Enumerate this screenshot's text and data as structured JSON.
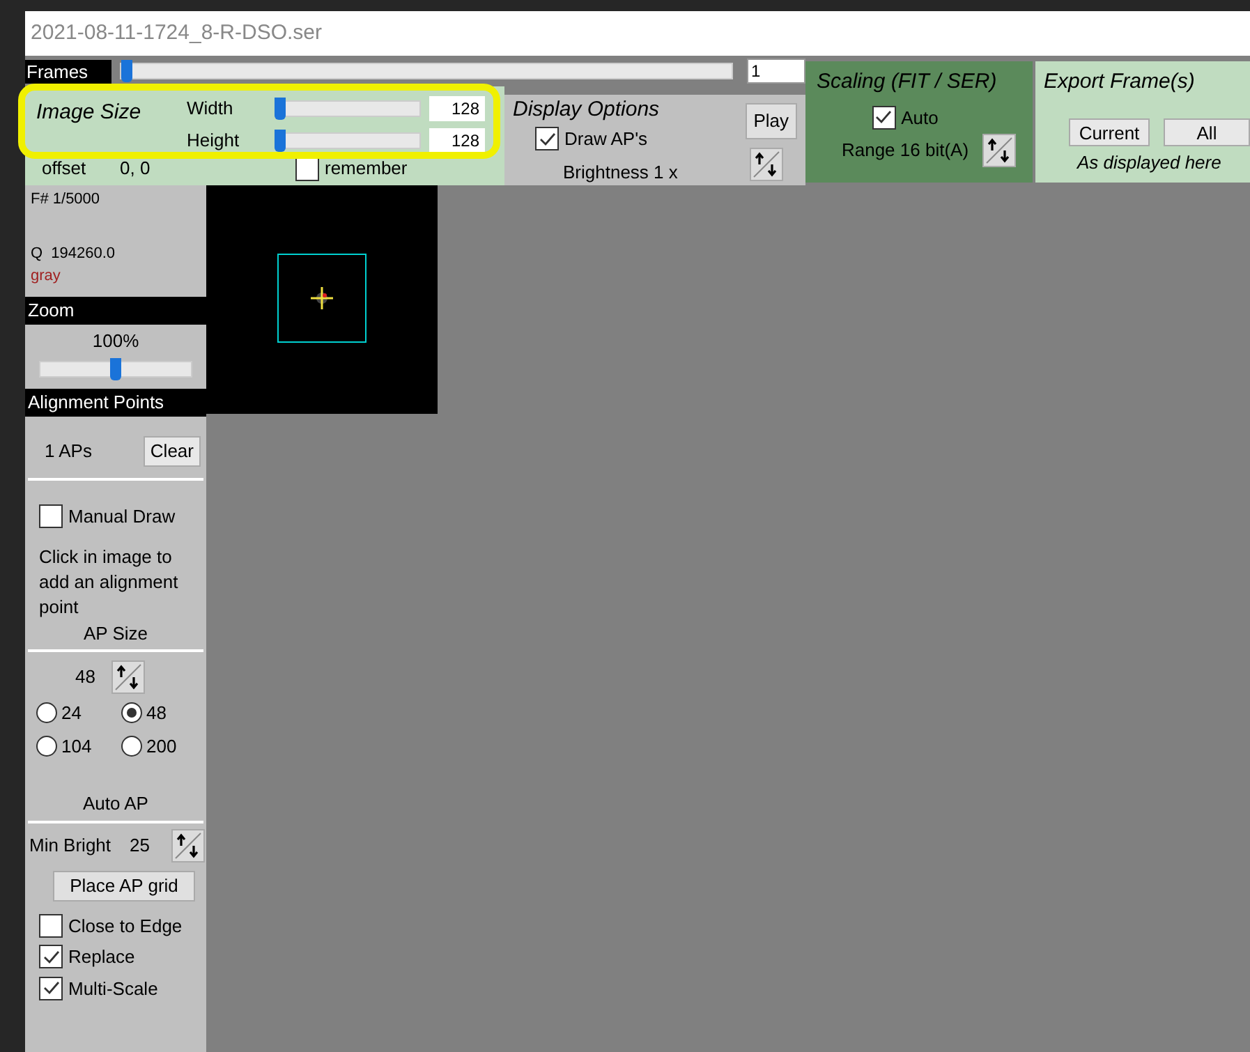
{
  "title": "2021-08-11-1724_8-R-DSO.ser",
  "frames": {
    "label": "Frames",
    "level": 0.01,
    "value": "1"
  },
  "image_size": {
    "title": "Image Size",
    "highlighted": true,
    "sliders": [
      {
        "label": "Width",
        "level": 0.02,
        "value": "128"
      },
      {
        "label": "Height",
        "level": 0.02,
        "value": "128"
      }
    ],
    "offset_label": "offset",
    "offset_value": "0, 0",
    "remember": {
      "label": "remember",
      "checked": false
    }
  },
  "display_options": {
    "title": "Display Options",
    "play": "Play",
    "draw_aps": {
      "label": "Draw AP's",
      "checked": true
    },
    "brightness": "Brightness 1 x"
  },
  "scaling": {
    "title": "Scaling (FIT / SER)",
    "auto": {
      "label": "Auto",
      "checked": true
    },
    "range": "Range 16 bit(A)"
  },
  "export": {
    "title": "Export Frame(s)",
    "buttons": [
      "Current",
      "All"
    ],
    "note": "As displayed here"
  },
  "info": {
    "frame": "F# 1/5000",
    "quality": "Q  194260.0",
    "color_mode": "gray"
  },
  "zoom": {
    "header": "Zoom",
    "value": "100%",
    "level": 0.5
  },
  "alignment": {
    "header": "Alignment Points",
    "count": "1 APs",
    "clear": "Clear",
    "manual_draw": {
      "label": "Manual Draw",
      "checked": false
    },
    "hint": "Click in image to add an alignment point",
    "ap_size_header": "AP Size",
    "ap_size_value": "48",
    "sizes": [
      {
        "label": "24",
        "selected": false
      },
      {
        "label": "48",
        "selected": true
      },
      {
        "label": "104",
        "selected": false
      },
      {
        "label": "200",
        "selected": false
      }
    ],
    "auto_header": "Auto AP",
    "min_bright_label": "Min Bright",
    "min_bright_value": "25",
    "place_grid": "Place AP grid",
    "options": [
      {
        "label": "Close to Edge",
        "checked": false
      },
      {
        "label": "Replace",
        "checked": true
      },
      {
        "label": "Multi-Scale",
        "checked": true
      }
    ]
  }
}
